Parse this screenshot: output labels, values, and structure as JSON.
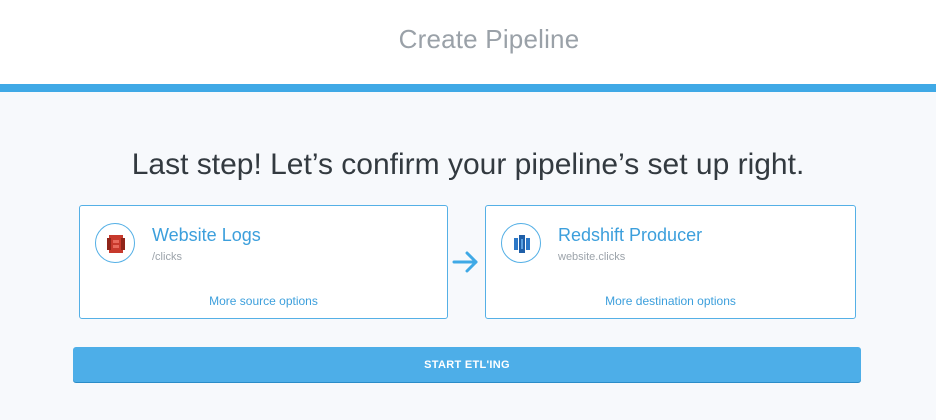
{
  "header": {
    "title": "Create Pipeline"
  },
  "headline": "Last step! Let’s confirm your pipeline’s set up right.",
  "source": {
    "title": "Website Logs",
    "subtitle": "/clicks",
    "link": "More source options",
    "icon": "s3-bucket-icon",
    "icon_color": "#c7392c"
  },
  "destination": {
    "title": "Redshift Producer",
    "subtitle": "website.clicks",
    "link": "More destination options",
    "icon": "redshift-icon",
    "icon_color": "#1f5fa8"
  },
  "action": {
    "start_label": "START ETL'ING"
  },
  "colors": {
    "accent": "#3fa9e6",
    "link": "#3c9fdc"
  }
}
